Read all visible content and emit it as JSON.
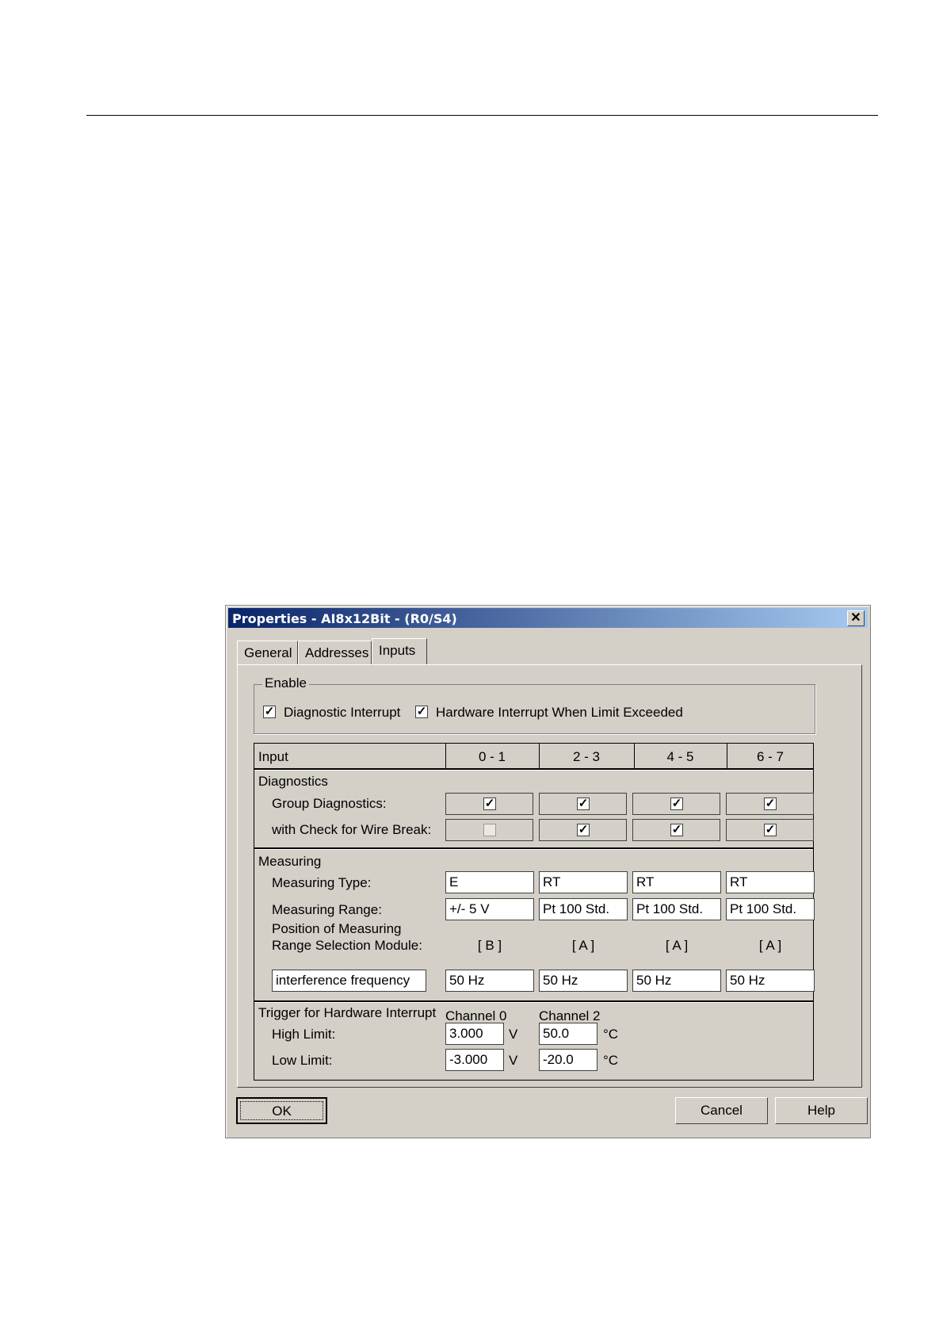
{
  "dialog": {
    "title": "Properties - AI8x12Bit - (R0/S4)",
    "close_glyph": "✕"
  },
  "tabs": [
    {
      "label": "General"
    },
    {
      "label": "Addresses"
    },
    {
      "label": "Inputs"
    }
  ],
  "enable": {
    "label": "Enable",
    "diagnostic_interrupt": {
      "label": "Diagnostic Interrupt",
      "checked": true
    },
    "hardware_interrupt": {
      "label": "Hardware Interrupt When Limit Exceeded",
      "checked": true
    }
  },
  "grid": {
    "header": {
      "input": "Input",
      "cols": [
        "0 - 1",
        "2 - 3",
        "4 - 5",
        "6 - 7"
      ]
    },
    "diagnostics": {
      "title": "Diagnostics",
      "group_label": "Group Diagnostics:",
      "group": [
        true,
        true,
        true,
        true
      ],
      "wire_label": "with Check for Wire Break:",
      "wire": [
        false,
        true,
        true,
        true
      ]
    },
    "measuring": {
      "title": "Measuring",
      "type_label": "Measuring Type:",
      "types": [
        "E",
        "RT",
        "RT",
        "RT"
      ],
      "range_label": "Measuring Range:",
      "ranges": [
        "+/- 5 V",
        "Pt 100 Std.",
        "Pt 100 Std.",
        "Pt 100 Std."
      ],
      "position_label_1": "Position of Measuring",
      "position_label_2": "Range Selection Module:",
      "positions": [
        "[ B ]",
        "[ A ]",
        "[ A ]",
        "[ A ]"
      ],
      "interference_label": "interference frequency",
      "frequencies": [
        "50 Hz",
        "50 Hz",
        "50 Hz",
        "50 Hz"
      ]
    },
    "trigger": {
      "title": "Trigger for Hardware Interrupt",
      "channel_a": "Channel 0",
      "channel_b": "Channel 2",
      "high_label": "High Limit:",
      "low_label": "Low Limit:",
      "high_a": "3.000",
      "unit_a": "V",
      "high_b": "50.0",
      "unit_b": "°C",
      "low_a": "-3.000",
      "low_b": "-20.0"
    }
  },
  "buttons": {
    "ok": "OK",
    "cancel": "Cancel",
    "help": "Help"
  }
}
